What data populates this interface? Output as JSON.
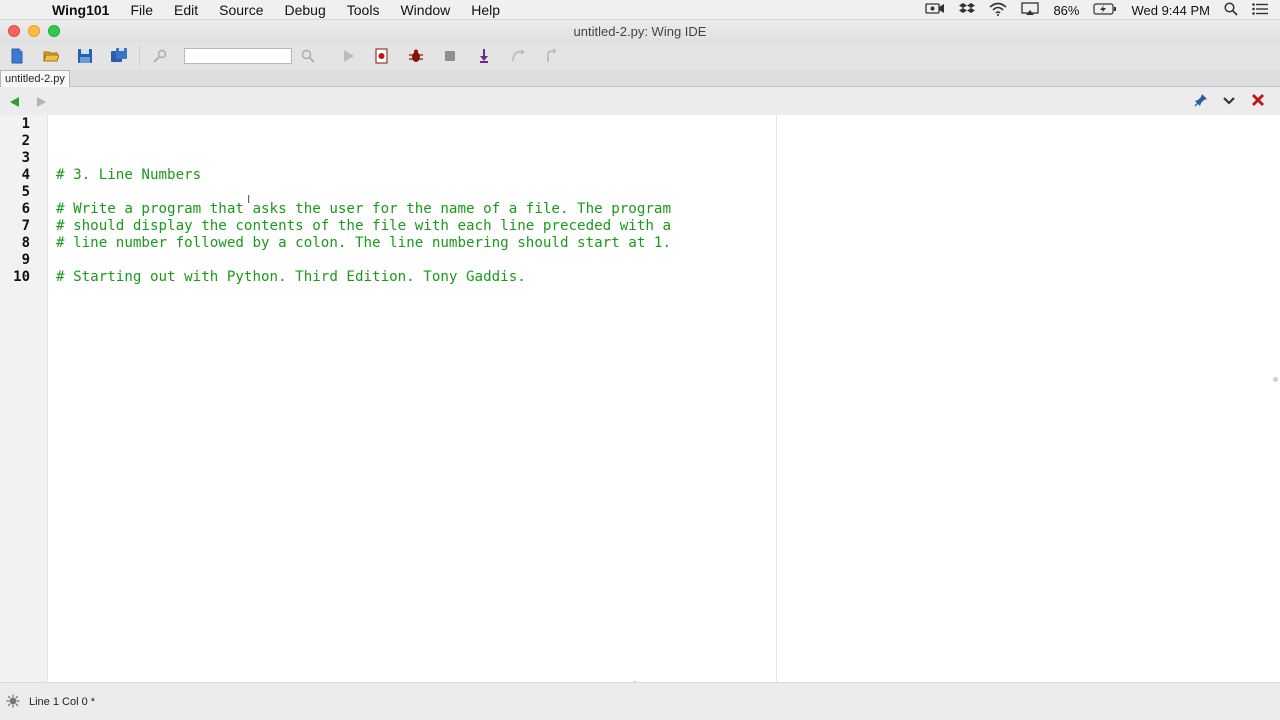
{
  "menubar": {
    "app_name": "Wing101",
    "items": [
      "File",
      "Edit",
      "Source",
      "Debug",
      "Tools",
      "Window",
      "Help"
    ],
    "battery": "86%",
    "clock": "Wed 9:44 PM"
  },
  "window": {
    "title": "untitled-2.py: Wing IDE"
  },
  "toolbar": {
    "search_value": ""
  },
  "editor": {
    "tab_label": "untitled-2.py",
    "line_numbers": [
      "1",
      "2",
      "3",
      "4",
      "5",
      "6",
      "7",
      "8",
      "9",
      "10"
    ],
    "lines": [
      "",
      "",
      "",
      "# 3. Line Numbers",
      "",
      "# Write a program that asks the user for the name of a file. The program",
      "# should display the contents of the file with each line preceded with a",
      "# line number followed by a colon. The line numbering should start at 1.",
      "",
      "# Starting out with Python. Third Edition. Tony Gaddis."
    ],
    "comment_color": "#1a9a1a",
    "cursor_glyph": "I"
  },
  "status": {
    "text": "Line 1 Col 0 *"
  },
  "colors": {
    "close_red": "#fc605c",
    "minimize_yellow": "#fdbc40",
    "maximize_green": "#34c84a",
    "nav_back_green": "#2fa02f",
    "editor_close_red": "#c0141a"
  }
}
